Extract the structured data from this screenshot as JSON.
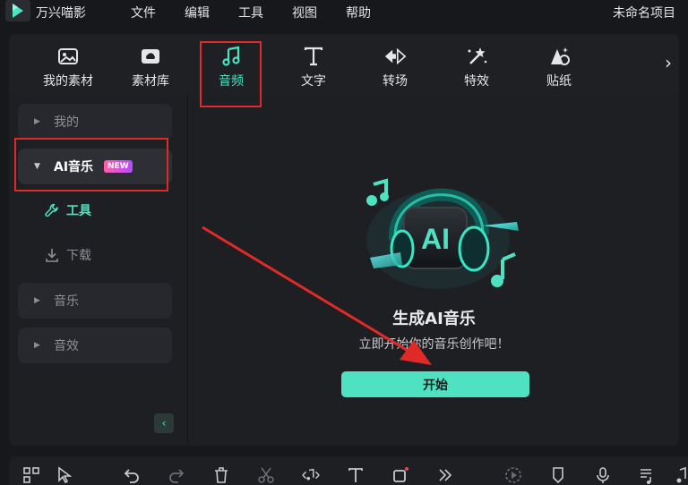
{
  "app": {
    "name": "万兴喵影",
    "project_name": "未命名项目"
  },
  "menu": {
    "items": [
      {
        "label": "文件"
      },
      {
        "label": "编辑"
      },
      {
        "label": "工具"
      },
      {
        "label": "视图"
      },
      {
        "label": "帮助"
      }
    ]
  },
  "toolbar": {
    "tabs": [
      {
        "label": "我的素材",
        "icon": "image-icon"
      },
      {
        "label": "素材库",
        "icon": "cloud-image-icon"
      },
      {
        "label": "音频",
        "icon": "music-note-icon",
        "active": true
      },
      {
        "label": "文字",
        "icon": "text-icon"
      },
      {
        "label": "转场",
        "icon": "transition-icon"
      },
      {
        "label": "特效",
        "icon": "effects-icon"
      },
      {
        "label": "贴纸",
        "icon": "sticker-icon"
      }
    ],
    "more": "›"
  },
  "sidebar": {
    "items": [
      {
        "label": "我的"
      },
      {
        "label": "AI音乐",
        "badge": "NEW",
        "expanded": true
      },
      {
        "label": "音乐"
      },
      {
        "label": "音效"
      }
    ],
    "sub_items": [
      {
        "label": "工具",
        "icon": "wrench-icon"
      },
      {
        "label": "下载",
        "icon": "download-icon"
      }
    ],
    "collapse": "‹"
  },
  "content": {
    "hero_text": "AI",
    "title": "生成AI音乐",
    "subtitle": "立即开始你的音乐创作吧！",
    "start_button": "开始"
  },
  "colors": {
    "accent": "#4ee2c2",
    "annotation": "#e02a2a",
    "badge_start": "#ff5fa8",
    "badge_end": "#b24cff"
  }
}
